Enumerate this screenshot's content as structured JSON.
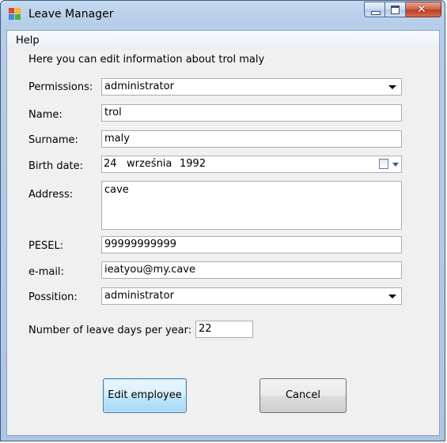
{
  "window": {
    "title": "Leave Manager"
  },
  "menu": {
    "items": [
      "Help"
    ]
  },
  "intro": "Here you can edit information about trol maly",
  "form": {
    "permissions": {
      "label": "Permissions:",
      "value": "administrator"
    },
    "name": {
      "label": "Name:",
      "value": "trol"
    },
    "surname": {
      "label": "Surname:",
      "value": "maly"
    },
    "birth_date": {
      "label": "Birth date:",
      "day": "24",
      "month": "września",
      "year": "1992"
    },
    "address": {
      "label": "Address:",
      "value": "cave"
    },
    "pesel": {
      "label": "PESEL:",
      "value": "99999999999"
    },
    "email": {
      "label": "e-mail:",
      "value": "ieatyou@my.cave"
    },
    "position": {
      "label": "Possition:",
      "value": "administrator"
    },
    "leave_days": {
      "label": "Number of leave days per year:",
      "value": "22"
    }
  },
  "buttons": {
    "edit": "Edit employee",
    "cancel": "Cancel"
  },
  "icons": {
    "app": "app-icon",
    "minimize": "minimize-icon",
    "maximize": "maximize-icon",
    "close": "close-icon",
    "calendar": "calendar-icon",
    "dropdown": "chevron-down-icon"
  },
  "colors": {
    "title_bar": "#b6cde8",
    "client_bg": "#f0f0f0",
    "close_button": "#c84a2f",
    "primary_button_border": "#3c7fb1"
  }
}
